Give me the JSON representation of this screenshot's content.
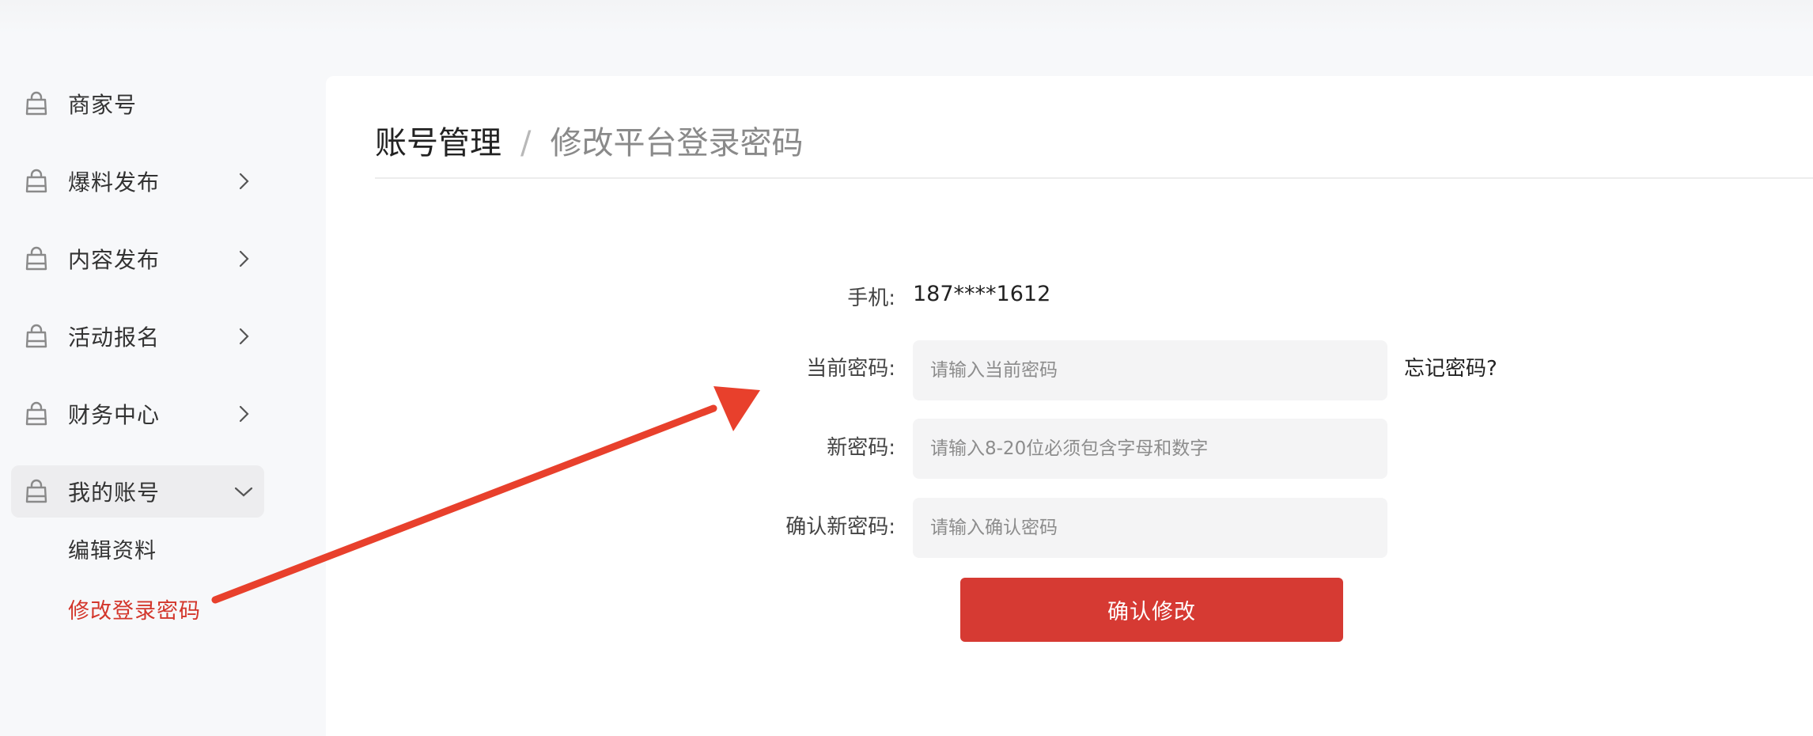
{
  "sidebar": {
    "items": [
      {
        "label": "商家号",
        "has_arrow": false
      },
      {
        "label": "爆料发布",
        "has_arrow": true
      },
      {
        "label": "内容发布",
        "has_arrow": true
      },
      {
        "label": "活动报名",
        "has_arrow": true
      },
      {
        "label": "财务中心",
        "has_arrow": true
      },
      {
        "label": "我的账号",
        "has_arrow": true,
        "expanded": true
      }
    ],
    "sub_items": [
      {
        "label": "编辑资料",
        "active": false
      },
      {
        "label": "修改登录密码",
        "active": true
      }
    ]
  },
  "breadcrumb": {
    "parent": "账号管理",
    "separator": "/",
    "current": "修改平台登录密码"
  },
  "form": {
    "phone_label": "手机:",
    "phone_value": "187****1612",
    "current_password_label": "当前密码:",
    "current_password_placeholder": "请输入当前密码",
    "forgot_password": "忘记密码?",
    "new_password_label": "新密码:",
    "new_password_placeholder": "请输入8-20位必须包含字母和数字",
    "confirm_password_label": "确认新密码:",
    "confirm_password_placeholder": "请输入确认密码",
    "submit_label": "确认修改"
  },
  "colors": {
    "accent": "#d63a33",
    "active_text": "#d3362b",
    "annotation_arrow": "#e8402c"
  },
  "icons": {
    "nav_icon": "shopping-bag-icon",
    "chevron_right": "chevron-right-icon",
    "chevron_down": "chevron-down-icon"
  }
}
